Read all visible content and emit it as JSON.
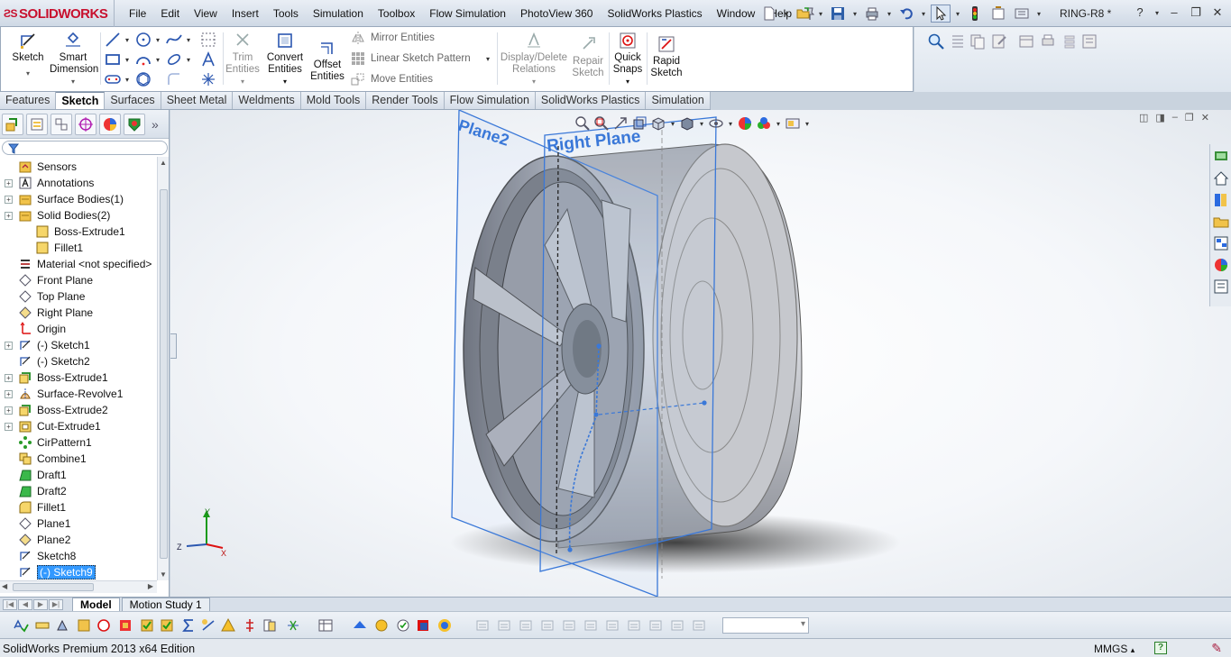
{
  "app": {
    "brand": "SOLIDWORKS",
    "doc_title": "RING-R8 *"
  },
  "menu": [
    "File",
    "Edit",
    "View",
    "Insert",
    "Tools",
    "Simulation",
    "Toolbox",
    "Flow Simulation",
    "PhotoView 360",
    "SolidWorks Plastics",
    "Window",
    "Help"
  ],
  "ribbon": {
    "sketch": "Sketch",
    "smart_dimension": [
      "Smart",
      "Dimension"
    ],
    "trim": [
      "Trim",
      "Entities"
    ],
    "convert": [
      "Convert",
      "Entities"
    ],
    "offset": [
      "Offset",
      "Entities"
    ],
    "mirror": "Mirror Entities",
    "linear_pattern": "Linear Sketch Pattern",
    "move": "Move Entities",
    "display_delete": [
      "Display/Delete",
      "Relations"
    ],
    "repair": [
      "Repair",
      "Sketch"
    ],
    "quick_snaps": [
      "Quick",
      "Snaps"
    ],
    "rapid_sketch": [
      "Rapid",
      "Sketch"
    ]
  },
  "tabs": [
    "Features",
    "Sketch",
    "Surfaces",
    "Sheet Metal",
    "Weldments",
    "Mold Tools",
    "Render Tools",
    "Flow Simulation",
    "SolidWorks Plastics",
    "Simulation"
  ],
  "active_tab": "Sketch",
  "tree": [
    {
      "label": "Sensors",
      "icon": "sensor",
      "exp": false,
      "child": false
    },
    {
      "label": "Annotations",
      "icon": "annotation",
      "exp": true,
      "child": false
    },
    {
      "label": "Surface Bodies(1)",
      "icon": "folder",
      "exp": true,
      "child": false
    },
    {
      "label": "Solid Bodies(2)",
      "icon": "folder",
      "exp": true,
      "child": false
    },
    {
      "label": "Boss-Extrude1",
      "icon": "body",
      "exp": false,
      "child": true
    },
    {
      "label": "Fillet1",
      "icon": "body",
      "exp": false,
      "child": true
    },
    {
      "label": "Material <not specified>",
      "icon": "material",
      "exp": false,
      "child": false
    },
    {
      "label": "Front Plane",
      "icon": "plane",
      "exp": false,
      "child": false
    },
    {
      "label": "Top Plane",
      "icon": "plane",
      "exp": false,
      "child": false
    },
    {
      "label": "Right Plane",
      "icon": "plane-hl",
      "exp": false,
      "child": false
    },
    {
      "label": "Origin",
      "icon": "origin",
      "exp": false,
      "child": false
    },
    {
      "label": "(-) Sketch1",
      "icon": "sketch",
      "exp": true,
      "child": false
    },
    {
      "label": "(-) Sketch2",
      "icon": "sketch",
      "exp": false,
      "child": false
    },
    {
      "label": "Boss-Extrude1",
      "icon": "extrude",
      "exp": true,
      "child": false
    },
    {
      "label": "Surface-Revolve1",
      "icon": "revolve",
      "exp": true,
      "child": false
    },
    {
      "label": "Boss-Extrude2",
      "icon": "extrude",
      "exp": true,
      "child": false
    },
    {
      "label": "Cut-Extrude1",
      "icon": "cut",
      "exp": true,
      "child": false
    },
    {
      "label": "CirPattern1",
      "icon": "pattern",
      "exp": false,
      "child": false
    },
    {
      "label": "Combine1",
      "icon": "combine",
      "exp": false,
      "child": false
    },
    {
      "label": "Draft1",
      "icon": "draft",
      "exp": false,
      "child": false
    },
    {
      "label": "Draft2",
      "icon": "draft",
      "exp": false,
      "child": false
    },
    {
      "label": "Fillet1",
      "icon": "fillet",
      "exp": false,
      "child": false
    },
    {
      "label": "Plane1",
      "icon": "plane",
      "exp": false,
      "child": false
    },
    {
      "label": "Plane2",
      "icon": "plane-hl",
      "exp": false,
      "child": false
    },
    {
      "label": "Sketch8",
      "icon": "sketch",
      "exp": false,
      "child": false
    },
    {
      "label": "(-) Sketch9",
      "icon": "sketch",
      "exp": false,
      "child": false,
      "selected": true
    }
  ],
  "viewport": {
    "plane_right": "Right Plane",
    "plane_2": "Plane2",
    "axis_x": "X",
    "axis_y": "Y",
    "axis_z": "Z"
  },
  "bottom_tabs": [
    "Model",
    "Motion Study 1"
  ],
  "active_bottom_tab": "Model",
  "status": {
    "text": "SolidWorks Premium 2013 x64 Edition",
    "units": "MMGS",
    "help": "?"
  },
  "colors": {
    "accent": "#c8102e",
    "plane": "#3a78d8",
    "selection": "#3399ff"
  }
}
